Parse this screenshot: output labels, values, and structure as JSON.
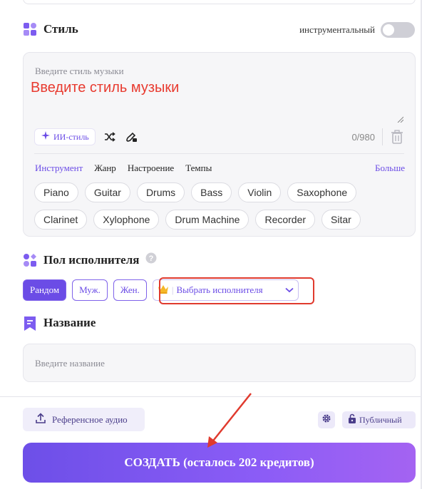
{
  "style_section": {
    "title": "Стиль",
    "instrumental_label": "инструментальный",
    "instrumental_on": false,
    "placeholder": "Введите стиль музыки",
    "overlay_text": "Введите стиль музыки",
    "ai_style_label": "ИИ-стиль",
    "counter": "0/980",
    "categories": [
      "Инструмент",
      "Жанр",
      "Настроение",
      "Темпы"
    ],
    "active_category": "Инструмент",
    "more_label": "Больше",
    "chips": [
      "Piano",
      "Guitar",
      "Drums",
      "Bass",
      "Violin",
      "Saxophone",
      "Clarinet",
      "Xylophone",
      "Drum Machine",
      "Recorder",
      "Sitar"
    ]
  },
  "gender_section": {
    "title": "Пол исполнителя",
    "options": [
      "Рандом",
      "Муж.",
      "Жен."
    ],
    "selected": "Рандом",
    "artist_select_label": "Выбрать исполнителя"
  },
  "name_section": {
    "title": "Название",
    "placeholder": "Введите название"
  },
  "footer": {
    "reference_audio_label": "Референсное аудио",
    "public_label": "Публичный",
    "create_label": "СОЗДАТЬ (осталось 202 кредитов)"
  },
  "colors": {
    "accent": "#6b4ce6",
    "annotation_red": "#e03a2e"
  }
}
